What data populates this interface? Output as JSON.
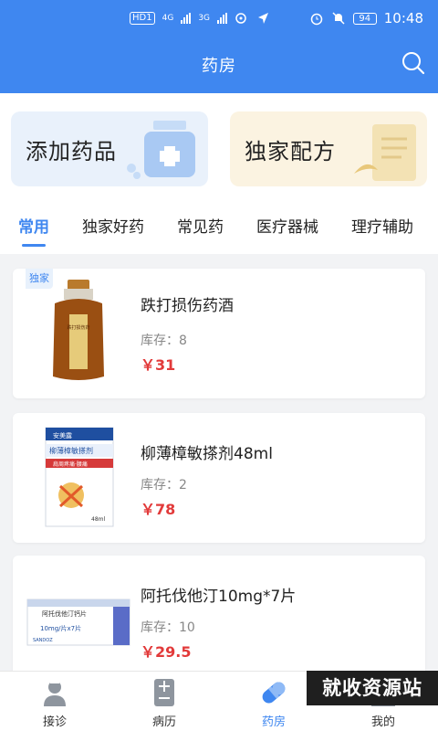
{
  "status_bar": {
    "hd_label": "HD",
    "sim_label": "1",
    "net1": "4G",
    "net2": "3G",
    "battery": "94",
    "time": "10:48"
  },
  "header": {
    "title": "药房"
  },
  "quick_cards": [
    {
      "label": "添加药品"
    },
    {
      "label": "独家配方"
    }
  ],
  "tabs": [
    {
      "label": "常用",
      "active": true
    },
    {
      "label": "独家好药"
    },
    {
      "label": "常见药"
    },
    {
      "label": "医疗器械"
    },
    {
      "label": "理疗辅助"
    }
  ],
  "products": [
    {
      "name": "跌打损伤药酒",
      "stock_label": "库存：",
      "stock": "8",
      "price": "￥31",
      "badge": "独家"
    },
    {
      "name": "柳薄樟敏搽剂48ml",
      "stock_label": "库存：",
      "stock": "2",
      "price": "￥78"
    },
    {
      "name": "阿托伐他汀10mg*7片",
      "stock_label": "库存：",
      "stock": "10",
      "price": "￥29.5"
    }
  ],
  "product_image_text": {
    "bottle_label": "跌打损伤药",
    "box2_brand": "安美露",
    "box2_title": "柳薄樟敏搽剂",
    "box2_sub": "肩周疼痛·腰痛",
    "box2_size": "48ml",
    "box3_title": "阿托伐他汀钙片",
    "box3_dose": "10mg/片x7片",
    "box3_brand": "SANDOZ"
  },
  "tabbar": [
    {
      "label": "接诊",
      "icon": "doctor-icon"
    },
    {
      "label": "病历",
      "icon": "record-icon"
    },
    {
      "label": "药房",
      "icon": "pill-icon",
      "active": true
    },
    {
      "label": "我的",
      "icon": "profile-icon"
    }
  ],
  "watermark": "就收资源站",
  "colors": {
    "primary": "#3f87f0",
    "price": "#e23a3a"
  }
}
